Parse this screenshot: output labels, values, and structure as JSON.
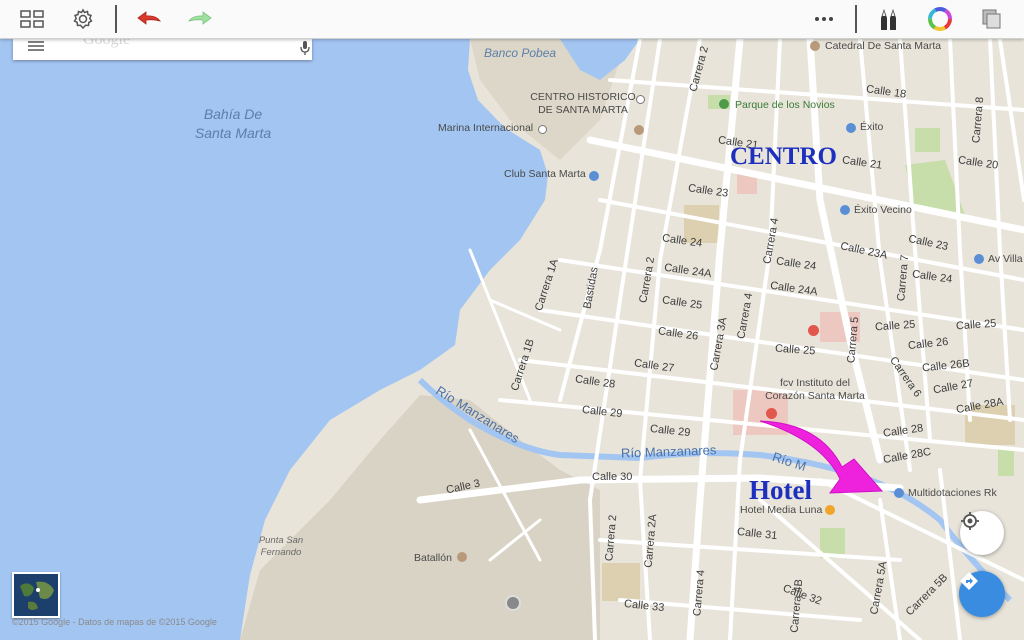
{
  "toolbar": {
    "icons": [
      "grid-icon",
      "settings-gear-icon",
      "undo-arrow-icon",
      "redo-arrow-icon",
      "more-options-icon",
      "pen-tools-icon",
      "color-wheel-icon",
      "layers-copy-icon"
    ],
    "colors": {
      "undo": "#d93a2b",
      "redo": "#9ee0a0"
    }
  },
  "search": {
    "placeholder": "Google"
  },
  "map": {
    "water_labels": {
      "bay_line1": "Bahía De",
      "bay_line2": "Santa Marta"
    },
    "places": {
      "banco_pobea": "Banco Pobea",
      "centro_line1": "CENTRO HISTORICO",
      "centro_line2": "DE SANTA MARTA",
      "marina": "Marina Internacional",
      "club": "Club Santa Marta",
      "catedral": "Catedral De Santa Marta",
      "parque": "Parque de los Novios",
      "exito": "Éxito",
      "exito_vecino": "Éxito Vecino",
      "av_villa": "Av Villa",
      "fcv_line1": "fcv Instituto del",
      "fcv_line2": "Corazón Santa Marta",
      "multidotaciones": "Multidotaciones Rk",
      "hotel_media_luna": "Hotel Media Luna",
      "punta_line1": "Punta San",
      "punta_line2": "Fernando",
      "batallon": "Batallón"
    },
    "streets": {
      "calle18": "Calle 18",
      "calle21a": "Calle 21",
      "calle21b": "Calle 21",
      "calle20": "Calle 20",
      "calle23a": "Calle 23",
      "calle23b": "Calle 23",
      "calle23A": "Calle 23A",
      "calle24a": "Calle 24",
      "calle24b": "Calle 24",
      "calle24c": "Calle 24",
      "calle24A": "Calle 24A",
      "calle24Ab": "Calle 24A",
      "calle25a": "Calle 25",
      "calle25b": "Calle 25",
      "calle25c": "Calle 25",
      "calle25d": "Calle 25",
      "calle26a": "Calle 26",
      "calle26b": "Calle 26",
      "calle26B": "Calle 26B",
      "calle27a": "Calle 27",
      "calle27b": "Calle 27",
      "calle28a": "Calle 28",
      "calle28b": "Calle 28",
      "calle28A": "Calle 28A",
      "calle28C": "Calle 28C",
      "calle29a": "Calle 29",
      "calle29b": "Calle 29",
      "calle30": "Calle 30",
      "calle31": "Calle 31",
      "calle32": "Calle 32",
      "calle33": "Calle 33",
      "calle3": "Calle 3",
      "carrera2a": "Carrera 2",
      "carrera2b": "Carrera 2",
      "carrera2c": "Carrera 2",
      "carrera2A": "Carrera 2A",
      "carrera3A": "Carrera 3A",
      "carrera4a": "Carrera 4",
      "carrera4b": "Carrera 4",
      "carrera4c": "Carrera 4",
      "carrera4B": "Carrera 4B",
      "carrera5": "Carrera 5",
      "carrera5A": "Carrera 5A",
      "carrera5B": "Carrera 5B",
      "carrera6": "Carrera 6",
      "carrera7": "Carrera 7",
      "carrera8": "Carrera 8",
      "carrera1A": "Carrera 1A",
      "carrera1B": "Carrera 1B",
      "bastidas": "Bastidas"
    },
    "rivers": {
      "rio1": "Río Manzanares",
      "rio2": "Río Manzanares",
      "rio3": "Río M"
    },
    "annotations": {
      "centro": "CENTRO",
      "hotel": "Hotel",
      "arrow_color": "#ee22dd"
    },
    "colors": {
      "water": "#a3c5f2",
      "land": "#e8e4da",
      "beach": "#d9d3c5",
      "park": "#c8deaa",
      "road": "#ffffff"
    }
  },
  "controls": {
    "my_location": "my-location-icon",
    "directions": "directions-icon",
    "thumbnail": "satellite-thumbnail"
  },
  "footer": {
    "copyright": "©2015 Google - Datos de mapas de ©2015 Google"
  }
}
